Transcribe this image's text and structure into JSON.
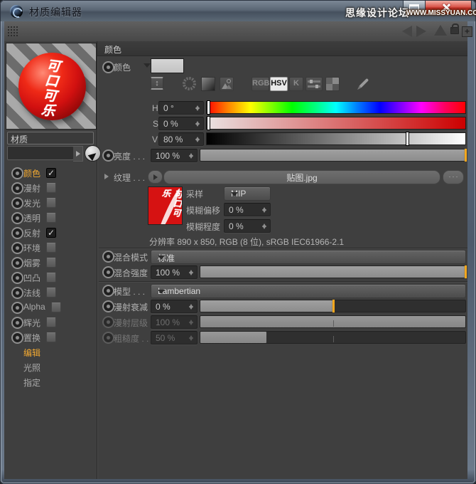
{
  "window": {
    "title": "材质编辑器",
    "watermark": {
      "line1": "思缘设计论坛",
      "line2": "WWW.MISSYUAN.COM"
    },
    "plus_glyph": "+"
  },
  "material": {
    "preview_text": "可口可乐",
    "name": "材质"
  },
  "channels": [
    {
      "label": "颜色",
      "check": "✓"
    },
    {
      "label": "漫射"
    },
    {
      "label": "发光"
    },
    {
      "label": "透明"
    },
    {
      "label": "反射",
      "check": "✓"
    },
    {
      "label": "环境"
    },
    {
      "label": "烟雾"
    },
    {
      "label": "凹凸"
    },
    {
      "label": "法线"
    },
    {
      "label": "Alpha"
    },
    {
      "label": "辉光"
    },
    {
      "label": "置换"
    }
  ],
  "pages": [
    {
      "label": "编辑"
    },
    {
      "label": "光照"
    },
    {
      "label": "指定"
    }
  ],
  "panel": {
    "header": "颜色",
    "color_label": "颜色",
    "modes": {
      "rgb": "RGB",
      "hsv": "HSV",
      "k": "K"
    },
    "h": {
      "label": "H",
      "value": "0 °",
      "marker": "0%"
    },
    "s": {
      "label": "S",
      "value": "0 %",
      "marker": "0%"
    },
    "v": {
      "label": "V",
      "value": "80 %",
      "marker": "77%"
    },
    "brightness": {
      "label": "亮度 . . .",
      "value": "100 %",
      "fill": "100%"
    },
    "texture": {
      "label": "纹理 . . .",
      "file": "贴图.jpg",
      "browse": ". . .",
      "thumb_text": "可口可乐",
      "sampling_label": "采样",
      "sampling": "MIP",
      "blur_offset_label": "模糊偏移",
      "blur_offset": "0 %",
      "blur_scale_label": "模糊程度",
      "blur_scale": "0 %",
      "info": "分辨率 890 x 850, RGB (8 位), sRGB IEC61966-2.1"
    },
    "mix_mode": {
      "label": "混合模式",
      "value": "标准"
    },
    "mix_strength": {
      "label": "混合强度",
      "value": "100 %",
      "fill": "100%"
    },
    "model": {
      "label": "模型 . . .",
      "value": "Lambertian"
    },
    "diffuse_falloff": {
      "label": "漫射衰减",
      "value": "0 %",
      "fill": "50%"
    },
    "diffuse_level": {
      "label": "漫射层级",
      "value": "100 %",
      "fill": "100%"
    },
    "roughness": {
      "label": "粗糙度 . .",
      "value": "50 %",
      "fill": "25%"
    }
  },
  "colors": {
    "accent": "#f2a71e",
    "selected_text": "#f0a832",
    "close_red": "#c0392b"
  }
}
